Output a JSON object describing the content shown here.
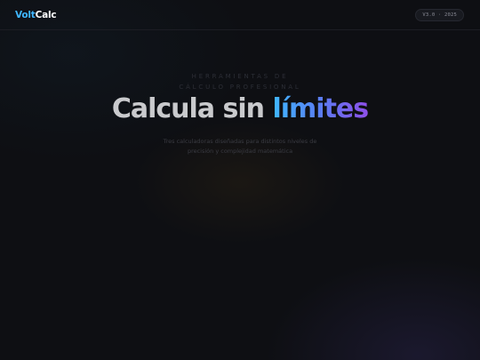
{
  "navbar": {
    "logo": {
      "part1": "Volt",
      "part2": "Calc"
    },
    "version_badge": "V3.0 · 2025"
  },
  "hero": {
    "kicker": "Herramientas de cálculo profesional",
    "headline_main": "Calcula sin ",
    "headline_accent": "límites",
    "subtitle": "Tres calculadoras diseñadas para distintos niveles de precisión y complejidad matemática"
  },
  "colors": {
    "background": "#0e0f13",
    "logo_accent": "#3fb6ff",
    "headline_gradient_start": "#3fb8ff",
    "headline_gradient_end": "#8d4fe8"
  }
}
